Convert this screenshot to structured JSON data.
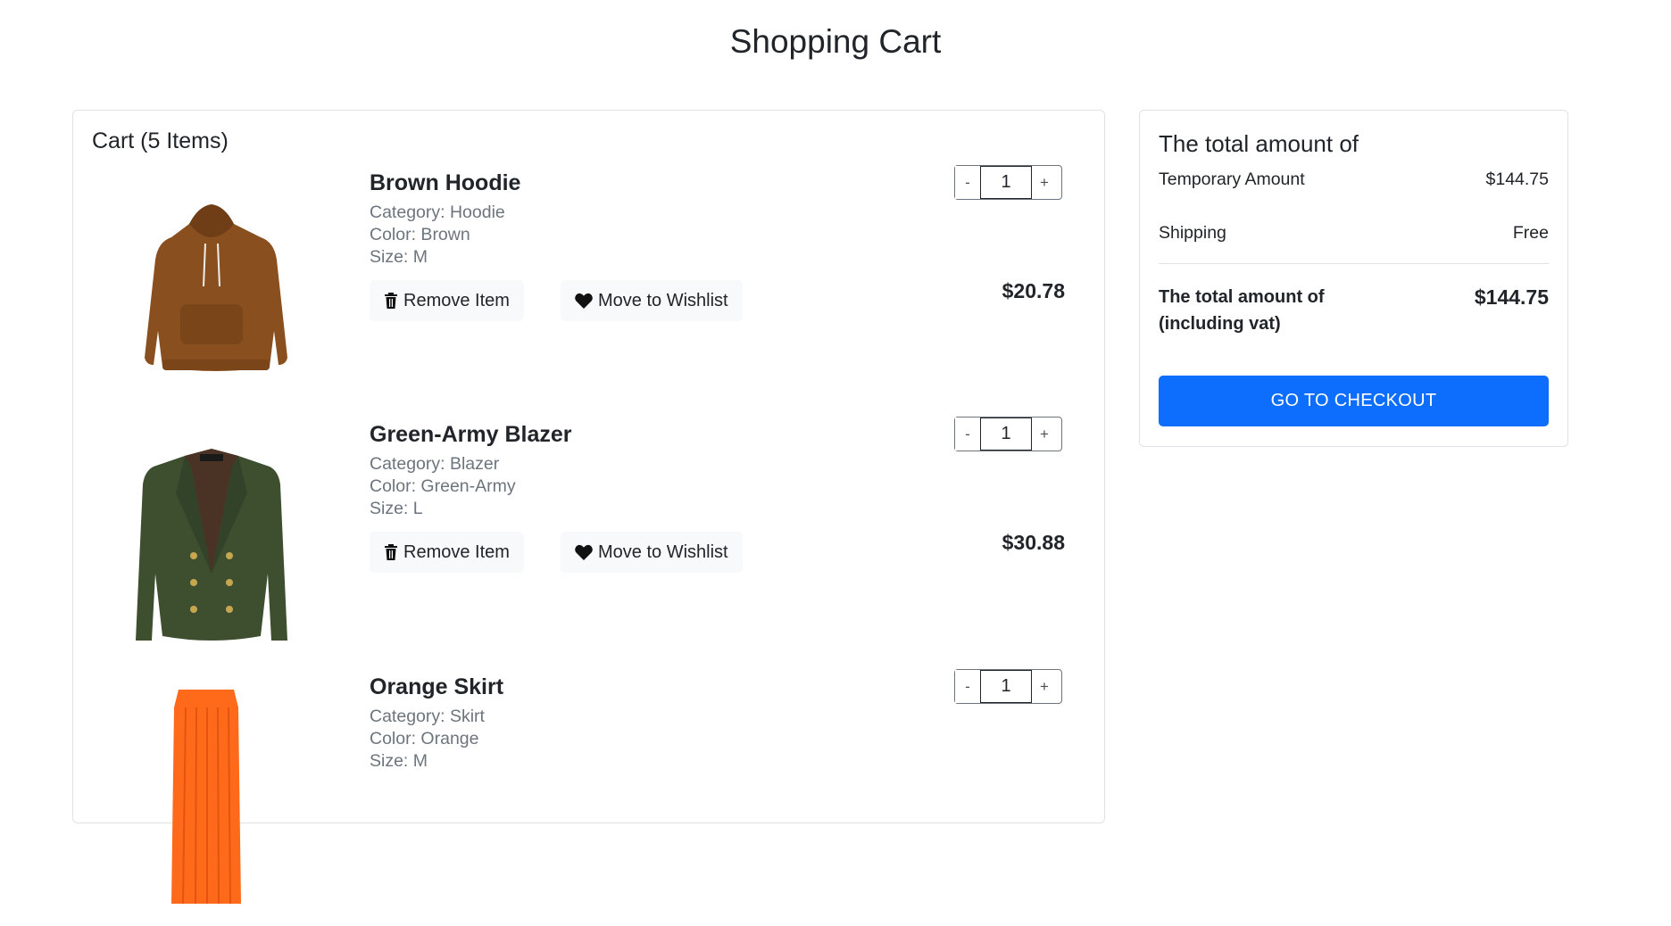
{
  "page": {
    "title": "Shopping Cart"
  },
  "cart": {
    "heading": "Cart (5 Items)",
    "remove_label": "Remove Item",
    "wishlist_label": "Move to Wishlist",
    "qty_minus": "-",
    "qty_plus": "+",
    "items": [
      {
        "name": "Brown Hoodie",
        "category": "Category: Hoodie",
        "color": "Color: Brown",
        "size": "Size: M",
        "quantity": "1",
        "price": "$20.78",
        "swatch": "#8a4f1e"
      },
      {
        "name": "Green-Army Blazer",
        "category": "Category: Blazer",
        "color": "Color: Green-Army",
        "size": "Size: L",
        "quantity": "1",
        "price": "$30.88",
        "swatch": "#3d4f2e"
      },
      {
        "name": "Orange Skirt",
        "category": "Category: Skirt",
        "color": "Color: Orange",
        "size": "Size: M",
        "quantity": "1",
        "price": "",
        "swatch": "#ff6a1a"
      }
    ]
  },
  "summary": {
    "title": "The total amount of",
    "temporary_label": "Temporary Amount",
    "temporary_value": "$144.75",
    "shipping_label": "Shipping",
    "shipping_value": "Free",
    "total_label": "The total amount of (including vat)",
    "total_value": "$144.75",
    "checkout_label": "GO TO CHECKOUT"
  },
  "colors": {
    "accent": "#0d6efd",
    "muted_text": "#6c757d",
    "border": "#dee2e6"
  },
  "icons": {
    "remove": "trash-icon",
    "wishlist": "heart-icon"
  }
}
